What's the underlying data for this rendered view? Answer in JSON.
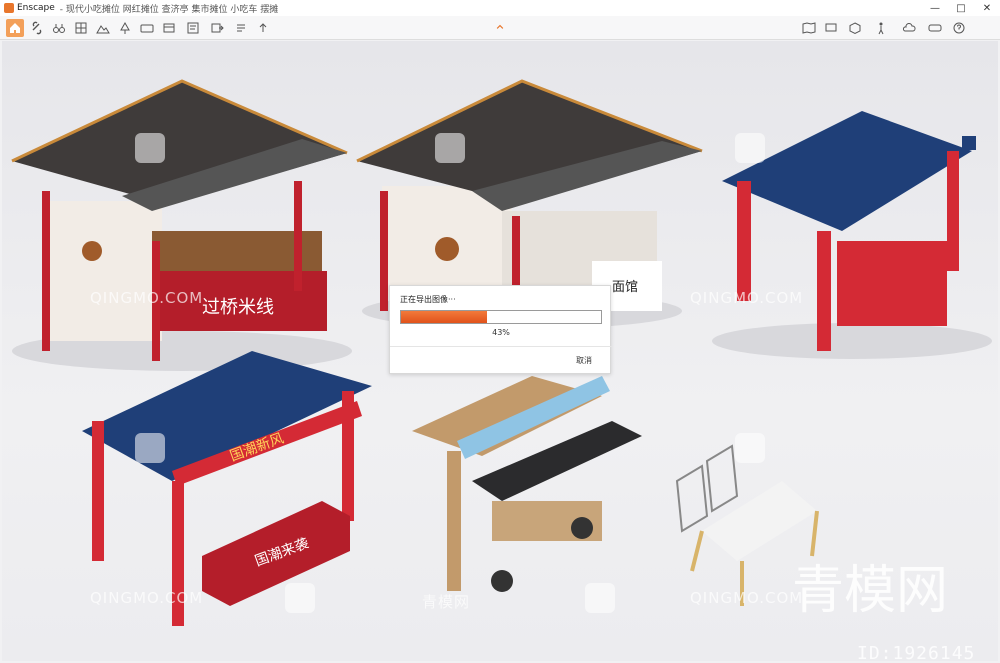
{
  "window": {
    "app_name": "Enscape",
    "file_title": "- 现代小吃摊位 网红摊位 查济亭 集市摊位 小吃车 摆摊",
    "minimize": "—",
    "maximize": "□",
    "close": "✕"
  },
  "toolbar": {
    "left_icons": [
      "home-icon",
      "link-icon",
      "binoculars-icon",
      "grid-icon",
      "mountain-icon",
      "tree-icon",
      "panorama-icon",
      "film-icon",
      "screenshot-icon",
      "export-icon",
      "batch-icon",
      "upload-icon"
    ],
    "right_icons": [
      "map-icon",
      "display-icon",
      "cube-icon",
      "walk-icon",
      "cloud-icon",
      "vr-icon",
      "help-icon"
    ]
  },
  "dialog": {
    "title": "正在导出图像···",
    "progress_percent": 43,
    "progress_text": "43%",
    "cancel_label": "取消",
    "accent": "#e8602a"
  },
  "scene": {
    "sign_guoqiao": "过桥米线",
    "sign_guochao": "国潮来袭",
    "banner_guochao": "国潮新风",
    "sign_shop2": "面馆"
  },
  "watermark": {
    "site": "QINGMO.COM",
    "site_cn": "青模网",
    "brand": "青模网",
    "id_text": "ID:1926145"
  }
}
